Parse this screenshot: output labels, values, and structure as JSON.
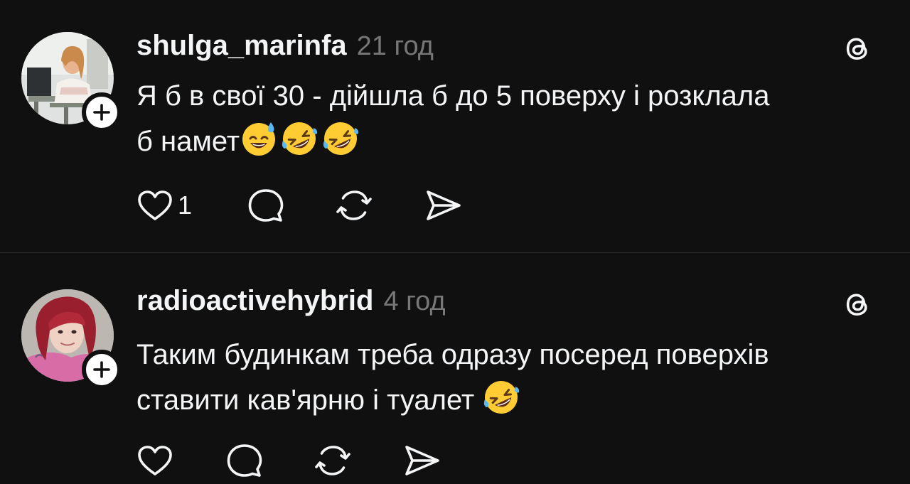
{
  "posts": [
    {
      "username": "shulga_marinfa",
      "time": "21 год",
      "text_line1": "Я б в свої 30 - дійшла б до 5 поверху і розклала",
      "text_line2": "б намет",
      "emojis": [
        "sweat-smile-emoji",
        "rofl-emoji",
        "rofl-emoji"
      ],
      "like_count": "1",
      "avatar": "profile-photo-woman-office"
    },
    {
      "username": "radioactivehybrid",
      "time": "4 год",
      "text_line1": "Таким будинкам треба одразу посеред поверхів",
      "text_line2": "ставити кав'ярню і туалет",
      "emojis": [
        "rofl-emoji"
      ],
      "like_count": "",
      "avatar": "profile-photo-red-hair"
    }
  ],
  "icons": {
    "like": "heart-icon",
    "reply": "comment-bubble-icon",
    "repost": "repost-icon",
    "share": "send-icon",
    "brand": "threads-logo-icon",
    "follow": "plus-icon"
  },
  "colors": {
    "background": "#101010",
    "text": "#f3f5f7",
    "muted": "#777777",
    "divider": "#2d2d2d"
  }
}
